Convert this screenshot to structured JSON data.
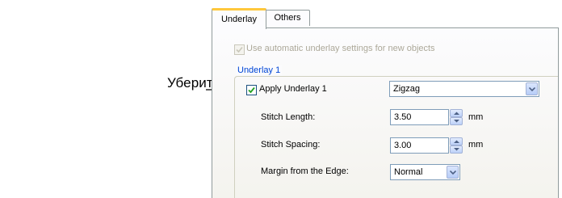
{
  "annotation": {
    "text": "Уберите флажок"
  },
  "tabs": [
    {
      "label": "Underlay",
      "active": true
    },
    {
      "label": "Others",
      "active": false
    }
  ],
  "auto_underlay": {
    "label": "Use automatic underlay settings for new objects",
    "checked": true,
    "enabled": false
  },
  "group": {
    "title": "Underlay 1",
    "apply": {
      "label": "Apply Underlay 1",
      "checked": true
    },
    "type_select": {
      "value": "Zigzag"
    },
    "stitch_length": {
      "label": "Stitch Length:",
      "value": "3.50",
      "unit": "mm"
    },
    "stitch_spacing": {
      "label": "Stitch Spacing:",
      "value": "3.00",
      "unit": "mm"
    },
    "margin": {
      "label": "Margin from the Edge:",
      "value": "Normal"
    }
  },
  "colors": {
    "accent_tab": "#ffc83c",
    "group_title": "#0046d5",
    "checkmark": "#21a121"
  },
  "icons": {
    "arrow": "arrow-right-icon",
    "check": "checkmark-icon",
    "dropdown": "chevron-down-icon",
    "spin": "spin-arrows-icon"
  }
}
